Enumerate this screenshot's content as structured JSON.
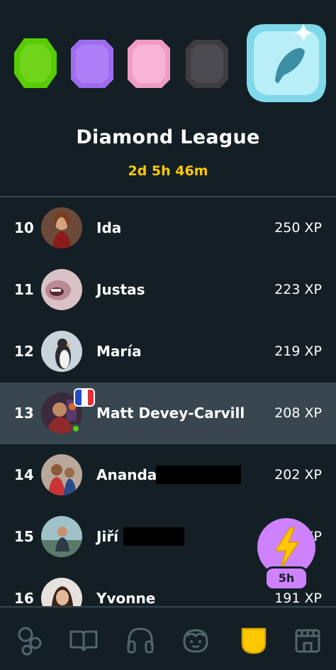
{
  "league": {
    "title": "Diamond League",
    "timer": "2d 5h 46m",
    "badges": [
      {
        "icon": "emerald-league-badge-icon",
        "color": "#58cc02"
      },
      {
        "icon": "amethyst-league-badge-icon",
        "color": "#a86cf5"
      },
      {
        "icon": "pearl-league-badge-icon",
        "color": "#f6a8cc"
      },
      {
        "icon": "obsidian-league-badge-icon",
        "color": "#4b4b4b"
      },
      {
        "icon": "diamond-league-badge-icon",
        "color": "#a7e8f3"
      }
    ]
  },
  "rows": [
    {
      "rank": "10",
      "name": "Ida",
      "xp": "250 XP"
    },
    {
      "rank": "11",
      "name": "Justas",
      "xp": "223 XP"
    },
    {
      "rank": "12",
      "name": "María",
      "xp": "219 XP"
    },
    {
      "rank": "13",
      "name": "Matt Devey-Carvill",
      "xp": "208 XP",
      "highlighted": true
    },
    {
      "rank": "14",
      "name": "Ananda",
      "xp": "202 XP"
    },
    {
      "rank": "15",
      "name": "Jiří",
      "xp": "XP"
    },
    {
      "rank": "16",
      "name": "Yvonne",
      "xp": "191 XP"
    }
  ],
  "boost": {
    "label": "5h",
    "icon": "lightning-bolt-icon"
  },
  "tabs": [
    {
      "icon": "learn-icon"
    },
    {
      "icon": "book-icon"
    },
    {
      "icon": "headphones-icon"
    },
    {
      "icon": "characters-icon"
    },
    {
      "icon": "league-shield-icon",
      "active": true
    },
    {
      "icon": "shop-icon"
    }
  ],
  "colors": {
    "background": "#131f24",
    "divider": "#37464f",
    "accent_gold": "#ffc800",
    "highlight_row": "#37464f",
    "boost_purple": "#ce82ff"
  }
}
